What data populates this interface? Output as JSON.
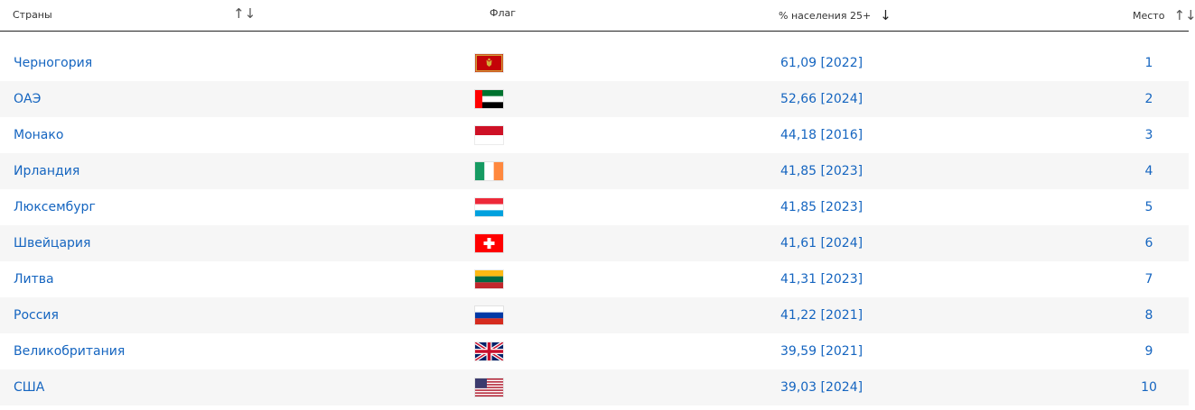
{
  "header": {
    "country_label": "Страны",
    "flag_label": "Флаг",
    "percent_label": "% населения 25+",
    "place_label": "Место",
    "sort_both_icon": "↑↓",
    "sort_desc_icon": "↓"
  },
  "rows": [
    {
      "country": "Черногория",
      "flag": "montenegro-flag",
      "value": "61,09 [2022]",
      "place": "1"
    },
    {
      "country": "ОАЭ",
      "flag": "uae-flag",
      "value": "52,66 [2024]",
      "place": "2"
    },
    {
      "country": "Монако",
      "flag": "monaco-flag",
      "value": "44,18 [2016]",
      "place": "3"
    },
    {
      "country": "Ирландия",
      "flag": "ireland-flag",
      "value": "41,85 [2023]",
      "place": "4"
    },
    {
      "country": "Люксембург",
      "flag": "luxembourg-flag",
      "value": "41,85 [2023]",
      "place": "5"
    },
    {
      "country": "Швейцария",
      "flag": "switzerland-flag",
      "value": "41,61 [2024]",
      "place": "6"
    },
    {
      "country": "Литва",
      "flag": "lithuania-flag",
      "value": "41,31 [2023]",
      "place": "7"
    },
    {
      "country": "Россия",
      "flag": "russia-flag",
      "value": "41,22 [2021]",
      "place": "8"
    },
    {
      "country": "Великобритания",
      "flag": "uk-flag",
      "value": "39,59 [2021]",
      "place": "9"
    },
    {
      "country": "США",
      "flag": "usa-flag",
      "value": "39,03 [2024]",
      "place": "10"
    }
  ],
  "colors": {
    "link": "#1565c0",
    "row_alt": "#f6f6f6",
    "header_border": "#222222"
  }
}
